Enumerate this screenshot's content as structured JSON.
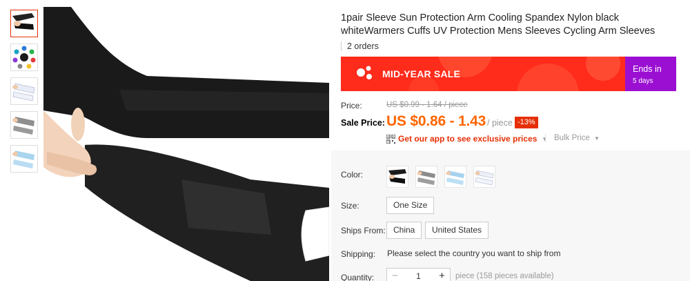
{
  "product": {
    "title": "1pair Sleeve Sun Protection Arm Cooling Spandex Nylon black whiteWarmers Cuffs UV Protection Mens Sleeves Cycling Arm Sleeves",
    "orders": "2 orders"
  },
  "sale_banner": {
    "label": "MID-YEAR SALE",
    "ends_label": "Ends in",
    "ends_days": "5 days",
    "colors": {
      "left": "#ff2b1b",
      "right": "#9b0fd2"
    }
  },
  "pricing": {
    "price_label": "Price:",
    "original_price": "US $0.99 - 1.64 / piece",
    "sale_label": "Sale Price:",
    "sale_price": "US $0.86 - 1.43",
    "unit": "/ piece",
    "discount": "-13%",
    "app_link": "Get our app to see exclusive prices",
    "bulk_price": "Bulk Price",
    "colors": {
      "sale_price": "#ff6600",
      "discount_bg": "#e62e04"
    }
  },
  "thumbnails": [
    {
      "icon": "black-sleeve-image"
    },
    {
      "icon": "color-swatches-image"
    },
    {
      "icon": "white-sleeve-image"
    },
    {
      "icon": "gray-sleeve-image"
    },
    {
      "icon": "light-blue-sleeve-image"
    }
  ],
  "options": {
    "color_label": "Color:",
    "colors": [
      "black",
      "gray",
      "light-blue",
      "white"
    ],
    "size_label": "Size:",
    "size_value": "One Size",
    "ships_from_label": "Ships From:",
    "ships_from": [
      "China",
      "United States"
    ],
    "shipping_label": "Shipping:",
    "shipping_text": "Please select the country you want to ship from",
    "quantity_label": "Quantity:",
    "quantity_minus": "−",
    "quantity_value": "1",
    "quantity_plus": "+",
    "quantity_available": "piece (158 pieces available)"
  }
}
